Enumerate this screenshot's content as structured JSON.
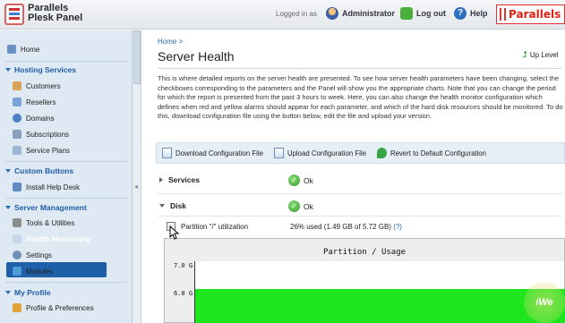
{
  "header": {
    "brand_line1": "Parallels",
    "brand_line2": "Plesk Panel",
    "logged_in_as": "Logged in as",
    "user": "Administrator",
    "logout": "Log out",
    "help": "Help",
    "parallels_logo": "Parallels"
  },
  "sidebar": {
    "home": "Home",
    "sections": [
      {
        "title": "Hosting Services",
        "items": [
          "Customers",
          "Resellers",
          "Domains",
          "Subscriptions",
          "Service Plans"
        ]
      },
      {
        "title": "Custom Buttons",
        "items": [
          "Install Help Desk"
        ]
      },
      {
        "title": "Server Management",
        "items": [
          "Tools & Utilities",
          "Health Monitoring",
          "Settings",
          "Modules"
        ]
      },
      {
        "title": "My Profile",
        "items": [
          "Profile & Preferences"
        ]
      }
    ],
    "active_item": "Health Monitoring"
  },
  "main": {
    "breadcrumb": "Home >",
    "title": "Server Health",
    "up_level": "Up Level",
    "description": "This is where detailed reports on the server health are presented. To see how server health parameters have been changing, select the checkboxes corresponding to the parameters and the Panel will show you the appropriate charts. Note that you can change the period for which the report is presented from the past 3 hours to week. Here, you can also change the health monitor configuration which defines when red and yellow alarms should appear for each parameter, and which of the hard disk resources should be monitored. To do this, download configuration file using the button below, edit the file and upload your version.",
    "toolbar": {
      "download": "Download Configuration File",
      "upload": "Upload Configuration File",
      "revert": "Revert to Default Configuration"
    },
    "services_label": "Services",
    "services_status": "Ok",
    "disk_label": "Disk",
    "disk_status": "Ok",
    "partition_label": "Partition \"/\" utilization",
    "partition_value": "26% used (1.49 GB of 5.72 GB)",
    "help_mark": "(?)",
    "chart": {
      "title": "Partition / Usage",
      "ticks": [
        "7.0 G",
        "6.0 G"
      ]
    },
    "watermark": "iWe"
  }
}
